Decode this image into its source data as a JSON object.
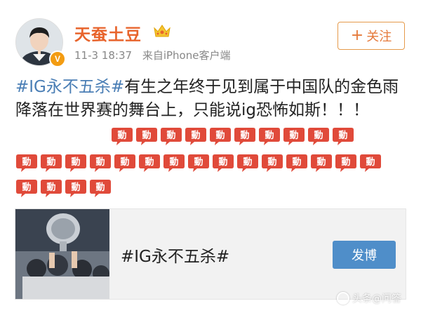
{
  "header": {
    "username": "天蚕土豆",
    "timestamp": "11-3 18:37",
    "source": "来自iPhone客户端",
    "follow_label": "关注",
    "follow_plus": "+",
    "verified_glyph": "V",
    "icons": [
      "avatar",
      "verified-badge-icon",
      "vip-crown-icon"
    ]
  },
  "post": {
    "hashtag": "#IG永不五杀#",
    "text": "有生之年终于见到属于中国队的金色雨降落在世界赛的舞台上，只能说ig恐怖如斯！！！",
    "emoji_name": "moved-emoji-icon",
    "emoji_rows": [
      10,
      15,
      4
    ]
  },
  "card": {
    "title": "#IG永不五杀#",
    "button_label": "发博",
    "image": "trophy-celebration-photo"
  },
  "watermark": {
    "text": "头条@问答"
  },
  "colors": {
    "username": "#e8642c",
    "hashtag": "#4a7eb5",
    "follow_border": "#e59a4b",
    "post_button": "#4f8ec9",
    "emoji": "#e04a3a"
  }
}
